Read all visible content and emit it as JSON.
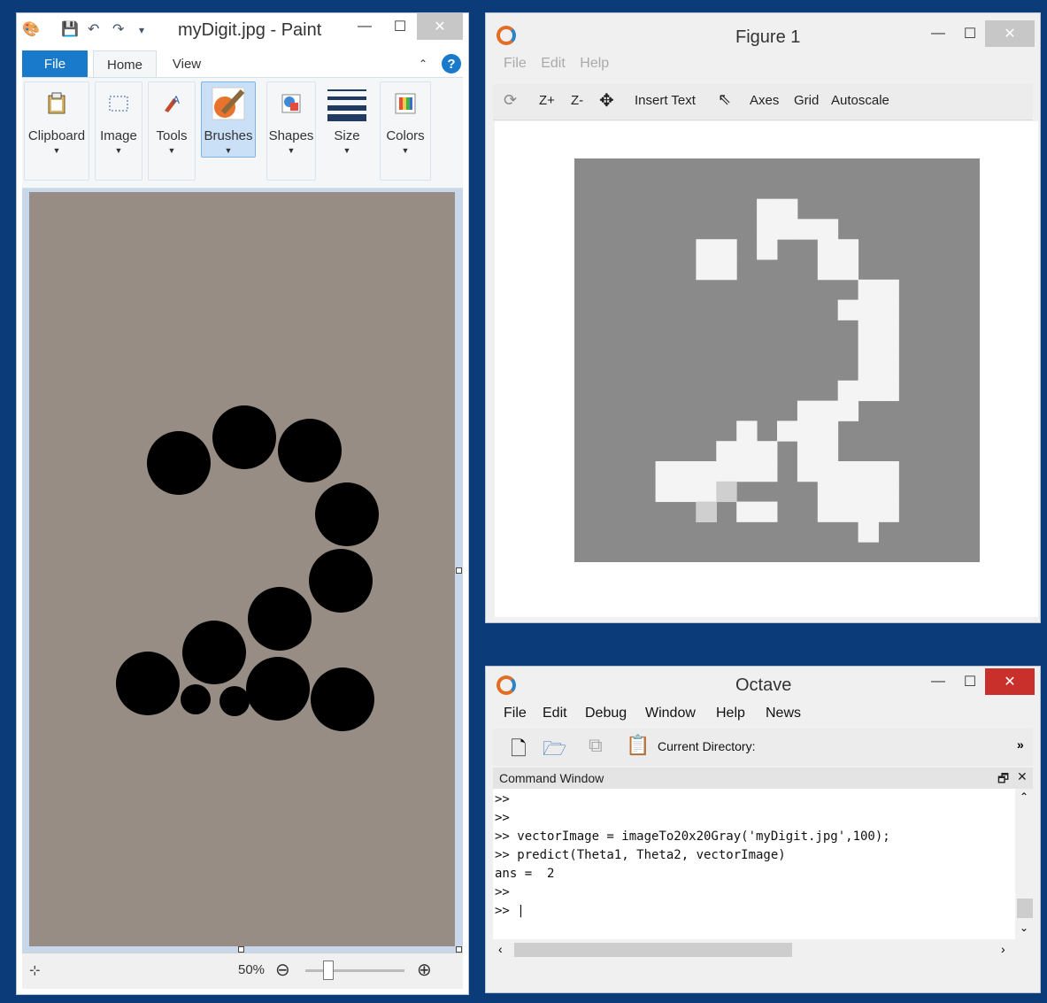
{
  "paint": {
    "title": "myDigit.jpg - Paint",
    "tabs": [
      "File",
      "Home",
      "View"
    ],
    "groups": [
      "Clipboard",
      "Image",
      "Tools",
      "Brushes",
      "Shapes",
      "Size",
      "Colors"
    ],
    "zoom": "50%",
    "help_glyph": "?"
  },
  "figure": {
    "title": "Figure 1",
    "menu": [
      "File",
      "Edit",
      "Help"
    ],
    "toolbar": [
      "Z+",
      "Z-",
      "Insert Text",
      "Axes",
      "Grid",
      "Autoscale"
    ],
    "heatmap_white": [
      [
        2,
        9
      ],
      [
        2,
        10
      ],
      [
        3,
        9
      ],
      [
        3,
        10
      ],
      [
        3,
        11
      ],
      [
        3,
        12
      ],
      [
        4,
        6
      ],
      [
        4,
        7
      ],
      [
        4,
        9
      ],
      [
        4,
        12
      ],
      [
        4,
        13
      ],
      [
        5,
        6
      ],
      [
        5,
        7
      ],
      [
        5,
        12
      ],
      [
        5,
        13
      ],
      [
        6,
        14
      ],
      [
        6,
        15
      ],
      [
        7,
        13
      ],
      [
        7,
        14
      ],
      [
        7,
        15
      ],
      [
        8,
        14
      ],
      [
        8,
        15
      ],
      [
        9,
        14
      ],
      [
        9,
        15
      ],
      [
        10,
        14
      ],
      [
        10,
        15
      ],
      [
        11,
        13
      ],
      [
        11,
        14
      ],
      [
        11,
        15
      ],
      [
        12,
        11
      ],
      [
        12,
        12
      ],
      [
        12,
        13
      ],
      [
        13,
        8
      ],
      [
        13,
        10
      ],
      [
        13,
        11
      ],
      [
        13,
        12
      ],
      [
        14,
        7
      ],
      [
        14,
        8
      ],
      [
        14,
        9
      ],
      [
        14,
        11
      ],
      [
        14,
        12
      ],
      [
        15,
        4
      ],
      [
        15,
        5
      ],
      [
        15,
        6
      ],
      [
        15,
        7
      ],
      [
        15,
        8
      ],
      [
        15,
        9
      ],
      [
        15,
        11
      ],
      [
        15,
        12
      ],
      [
        15,
        13
      ],
      [
        15,
        14
      ],
      [
        15,
        15
      ],
      [
        16,
        4
      ],
      [
        16,
        5
      ],
      [
        16,
        6
      ],
      [
        16,
        12
      ],
      [
        16,
        13
      ],
      [
        16,
        14
      ],
      [
        16,
        15
      ],
      [
        17,
        6
      ],
      [
        17,
        8
      ],
      [
        17,
        9
      ],
      [
        17,
        12
      ],
      [
        17,
        13
      ],
      [
        17,
        14
      ],
      [
        17,
        15
      ],
      [
        18,
        14
      ]
    ],
    "heatmap_light": [
      [
        16,
        7
      ],
      [
        17,
        6
      ]
    ]
  },
  "octave": {
    "title": "Octave",
    "menu": [
      "File",
      "Edit",
      "Debug",
      "Window",
      "Help",
      "News"
    ],
    "current_directory_label": "Current Directory:",
    "command_window_label": "Command Window",
    "lines": [
      ">>",
      ">>",
      ">> vectorImage = imageTo20x20Gray('myDigit.jpg',100);",
      ">> predict(Theta1, Theta2, vectorImage)",
      "ans =  2",
      ">>",
      ">> |"
    ]
  }
}
